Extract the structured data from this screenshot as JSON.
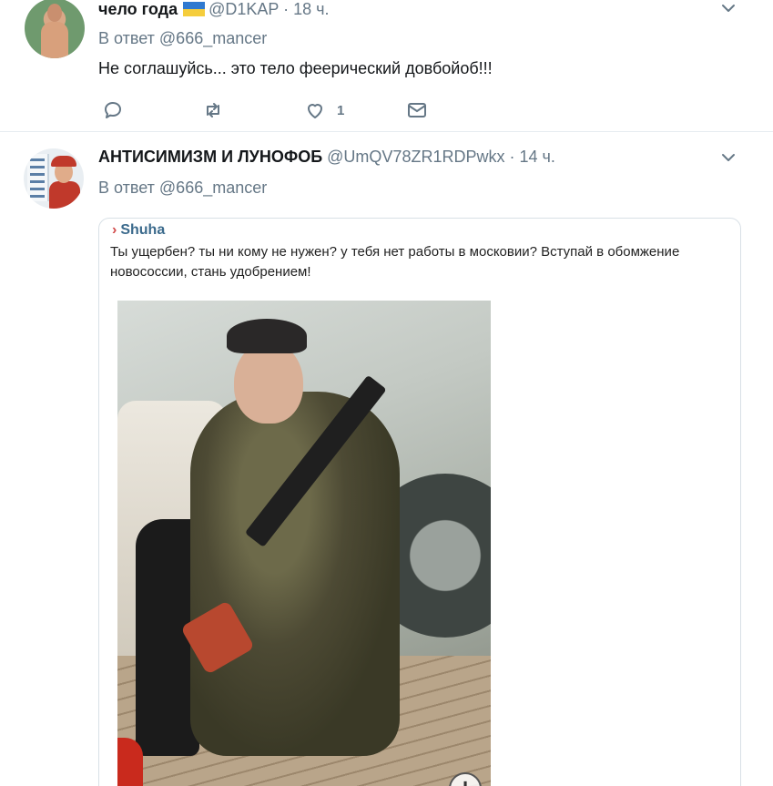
{
  "tweets": [
    {
      "name": "чело года",
      "handle": "@D1KAP",
      "separator": "·",
      "time": "18 ч.",
      "reply_prefix": "В ответ",
      "reply_to": "@666_mancer",
      "text": "Не соглашуйсь... это тело феерический довбойоб!!!",
      "like_count": "1"
    },
    {
      "name": "АНТИСИМИЗМ И ЛУНОФОБ",
      "handle": "@UmQV78ZR1RDPwkx",
      "separator": "·",
      "time": "14 ч.",
      "reply_prefix": "В ответ",
      "reply_to": "@666_mancer",
      "media": {
        "quote_user": "Shuha",
        "quote_arrow": "›",
        "quote_text": "Ты ущербен? ты ни кому не нужен? у тебя нет работы в московии? Вступай в обомжение новососсии, стань удобрением!",
        "expand_label": "+"
      }
    }
  ],
  "colors": {
    "secondary_text": "#657786",
    "divider": "#e6ecf0",
    "quote_user": "#3b6a8c",
    "flag_blue": "#2f79d0",
    "flag_yellow": "#f5cd3c"
  }
}
